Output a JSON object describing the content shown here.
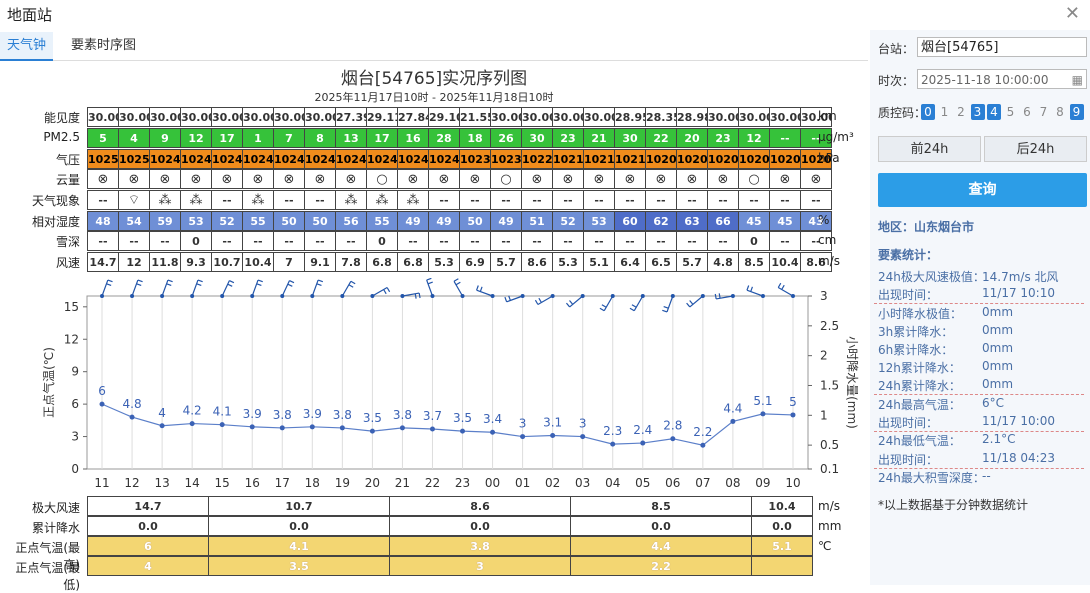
{
  "window": {
    "title": "地面站"
  },
  "tabs": [
    "天气钟",
    "要素时序图"
  ],
  "chart_data": {
    "type": "line",
    "title": "烟台[54765]实况序列图",
    "subtitle": "2025年11月17日10时 - 2025年11月18日10时",
    "x": [
      "11",
      "12",
      "13",
      "14",
      "15",
      "16",
      "17",
      "18",
      "19",
      "20",
      "21",
      "22",
      "23",
      "00",
      "01",
      "02",
      "03",
      "04",
      "05",
      "06",
      "07",
      "08",
      "09",
      "10"
    ],
    "series": [
      {
        "name": "正点气温(℃)",
        "values": [
          6,
          4.8,
          4,
          4.2,
          4.1,
          3.9,
          3.8,
          3.9,
          3.8,
          3.5,
          3.8,
          3.7,
          3.5,
          3.4,
          3,
          3.1,
          3,
          2.3,
          2.4,
          2.8,
          2.2,
          4.4,
          5.1,
          5
        ]
      },
      {
        "name": "小时降水量(mm)",
        "values": [
          0,
          0,
          0,
          0,
          0,
          0,
          0,
          0,
          0,
          0,
          0,
          0,
          0,
          0,
          0,
          0,
          0,
          0,
          0,
          0,
          0,
          0,
          0,
          0
        ]
      }
    ],
    "ylabel": "正点气温(℃)",
    "y2label": "小时降水量(mm)",
    "ylim": [
      0,
      16
    ],
    "y2lim": [
      0.1,
      3
    ],
    "yticks": [
      "0",
      "3",
      "6",
      "9",
      "12",
      "15"
    ],
    "y2ticks": [
      "0.1",
      "0.5",
      "1",
      "1.5",
      "2",
      "2.5",
      "3"
    ],
    "wind_dir_deg": [
      20,
      20,
      20,
      20,
      25,
      20,
      25,
      20,
      30,
      60,
      80,
      340,
      330,
      290,
      250,
      240,
      230,
      210,
      210,
      200,
      230,
      260,
      290,
      300
    ],
    "grid": true
  },
  "rows": [
    {
      "label": "能见度",
      "unit": "km",
      "style": "plain",
      "values": [
        "30.00",
        "30.00",
        "30.00",
        "30.00",
        "30.00",
        "30.00",
        "30.00",
        "30.00",
        "27.39",
        "29.11",
        "27.84",
        "29.10",
        "21.55",
        "30.00",
        "30.00",
        "30.00",
        "30.00",
        "28.95",
        "28.35",
        "28.98",
        "30.00",
        "30.00",
        "30.00",
        "30.00"
      ]
    },
    {
      "label": "PM2.5",
      "unit": "μg/m³",
      "style": "green",
      "values": [
        "5",
        "4",
        "9",
        "12",
        "17",
        "1",
        "7",
        "8",
        "13",
        "17",
        "16",
        "28",
        "18",
        "26",
        "30",
        "23",
        "21",
        "30",
        "22",
        "20",
        "23",
        "12",
        "--",
        "--"
      ]
    },
    {
      "label": "气压",
      "unit": "hPa",
      "style": "orange",
      "values": [
        "1025",
        "1025",
        "1024",
        "1024",
        "1024",
        "1024",
        "1024",
        "1024",
        "1024",
        "1024",
        "1024",
        "1024",
        "1023",
        "1023",
        "1022",
        "1021",
        "1021",
        "1021",
        "1020",
        "1020",
        "1020",
        "1020",
        "1020",
        "1020"
      ]
    },
    {
      "label": "云量",
      "unit": "",
      "style": "plain",
      "values": [
        "⊗",
        "⊗",
        "⊗",
        "⊗",
        "⊗",
        "⊗",
        "⊗",
        "⊗",
        "⊗",
        "○",
        "⊗",
        "⊗",
        "⊗",
        "○",
        "⊗",
        "⊗",
        "⊗",
        "⊗",
        "⊗",
        "⊗",
        "⊗",
        "○",
        "⊗",
        "⊗"
      ]
    },
    {
      "label": "天气现象",
      "unit": "",
      "style": "plain",
      "values": [
        "--",
        "⌔",
        "⁂",
        "⁂",
        "--",
        "⁂",
        "--",
        "--",
        "⁂",
        "⁂",
        "⁂",
        "--",
        "--",
        "--",
        "--",
        "--",
        "--",
        "--",
        "--",
        "--",
        "--",
        "--",
        "--",
        "--"
      ]
    },
    {
      "label": "相对湿度",
      "unit": "%",
      "style": "humid",
      "values": [
        "48",
        "54",
        "59",
        "53",
        "52",
        "55",
        "50",
        "50",
        "56",
        "55",
        "49",
        "49",
        "50",
        "49",
        "51",
        "52",
        "53",
        "60",
        "62",
        "63",
        "66",
        "45",
        "45",
        "43"
      ]
    },
    {
      "label": "雪深",
      "unit": "cm",
      "style": "plain",
      "values": [
        "--",
        "--",
        "--",
        "0",
        "--",
        "--",
        "--",
        "--",
        "--",
        "0",
        "--",
        "--",
        "--",
        "--",
        "--",
        "--",
        "--",
        "--",
        "--",
        "--",
        "--",
        "0",
        "--",
        "--"
      ]
    },
    {
      "label": "风速",
      "unit": "m/s",
      "style": "plain",
      "values": [
        "14.7",
        "12",
        "11.8",
        "9.3",
        "10.7",
        "10.4",
        "7",
        "9.1",
        "7.8",
        "6.8",
        "6.8",
        "5.3",
        "6.9",
        "5.7",
        "8.6",
        "5.3",
        "5.1",
        "6.4",
        "6.5",
        "5.7",
        "4.8",
        "8.5",
        "10.4",
        "8.6"
      ]
    }
  ],
  "bottom_rows": [
    {
      "label": "极大风速",
      "unit": "m/s",
      "values": [
        "14.7",
        "10.7",
        "8.6",
        "8.5",
        "10.4"
      ]
    },
    {
      "label": "累计降水",
      "unit": "mm",
      "values": [
        "0.0",
        "0.0",
        "0.0",
        "0.0",
        "0.0"
      ]
    },
    {
      "label": "正点气温(最高)",
      "unit": "℃",
      "values": [
        "6",
        "4.1",
        "3.8",
        "4.4",
        "5.1"
      ]
    },
    {
      "label": "正点气温(最低)",
      "unit": "",
      "values": [
        "4",
        "3.5",
        "3",
        "2.2",
        ""
      ]
    }
  ],
  "panel": {
    "station_label": "台站：",
    "station_value": "烟台[54765]",
    "time_label": "时次：",
    "time_value": "2025-11-18 10:00:00",
    "qc_label": "质控码：",
    "qc_codes": [
      {
        "code": "0",
        "on": true
      },
      {
        "code": "1",
        "on": false
      },
      {
        "code": "2",
        "on": false
      },
      {
        "code": "3",
        "on": true
      },
      {
        "code": "4",
        "on": true
      },
      {
        "code": "5",
        "on": false
      },
      {
        "code": "6",
        "on": false
      },
      {
        "code": "7",
        "on": false
      },
      {
        "code": "8",
        "on": false
      },
      {
        "code": "9",
        "on": true
      }
    ],
    "prev_label": "前24h",
    "next_label": "后24h",
    "query_label": "查询",
    "region": "地区：山东烟台市",
    "stats_title": "要素统计：",
    "stats": [
      {
        "k": "24h极大风速极值：",
        "v": "14.7m/s 北风"
      },
      {
        "k": "出现时间：",
        "v": "11/17 10:10"
      },
      {
        "k": "小时降水极值：",
        "v": "0mm"
      },
      {
        "k": "3h累计降水：",
        "v": "0mm"
      },
      {
        "k": "6h累计降水：",
        "v": "0mm"
      },
      {
        "k": "12h累计降水：",
        "v": "0mm"
      },
      {
        "k": "24h累计降水：",
        "v": "0mm"
      },
      {
        "k": "24h最高气温：",
        "v": "6°C"
      },
      {
        "k": "出现时间：",
        "v": "11/17 10:00"
      },
      {
        "k": "24h最低气温：",
        "v": "2.1°C"
      },
      {
        "k": "出现时间：",
        "v": "11/18 04:23"
      },
      {
        "k": "24h最大积雪深度：",
        "v": "--"
      }
    ],
    "note": "*以上数据基于分钟数据统计"
  }
}
